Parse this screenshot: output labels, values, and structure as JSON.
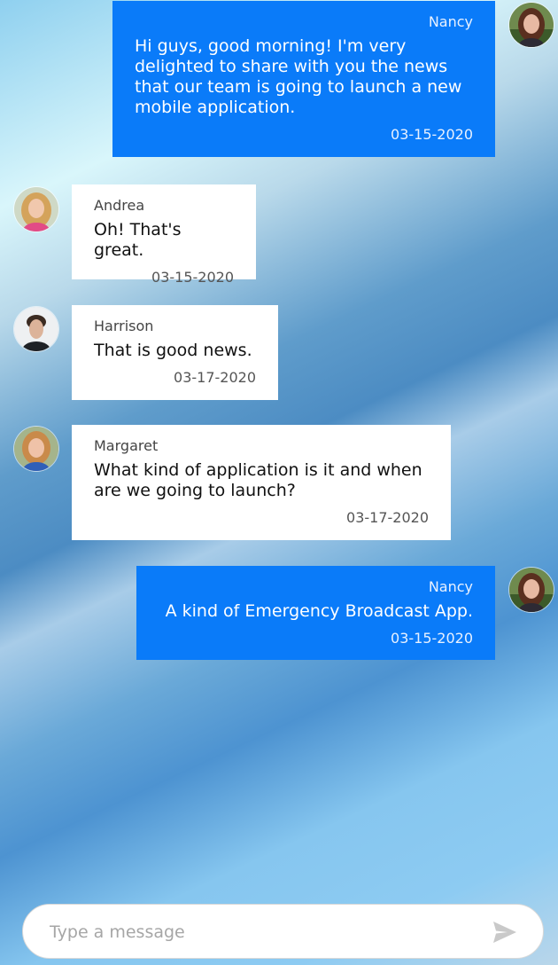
{
  "messages": [
    {
      "author": "Nancy",
      "text": "Hi guys, good morning! I'm very delighted to share with you the news that our team is going to launch a new mobile application.",
      "time": "03-15-2020",
      "direction": "outgoing",
      "avatar": "avatar-nancy"
    },
    {
      "author": "Andrea",
      "text": "Oh! That's great.",
      "time": "03-15-2020",
      "direction": "incoming",
      "avatar": "avatar-andrea"
    },
    {
      "author": "Harrison",
      "text": "That is good news.",
      "time": "03-17-2020",
      "direction": "incoming",
      "avatar": "avatar-harrison"
    },
    {
      "author": "Margaret",
      "text": "What kind of application is it and when are we going to launch?",
      "time": "03-17-2020",
      "direction": "incoming",
      "avatar": "avatar-margaret"
    },
    {
      "author": "Nancy",
      "text": "A kind of Emergency Broadcast App.",
      "time": "03-15-2020",
      "direction": "outgoing",
      "avatar": "avatar-nancy"
    }
  ],
  "composer": {
    "placeholder": "Type a message",
    "value": "",
    "send_icon": "send-icon"
  },
  "colors": {
    "outgoing_bubble": "#0a7bf9",
    "incoming_bubble": "#ffffff"
  }
}
